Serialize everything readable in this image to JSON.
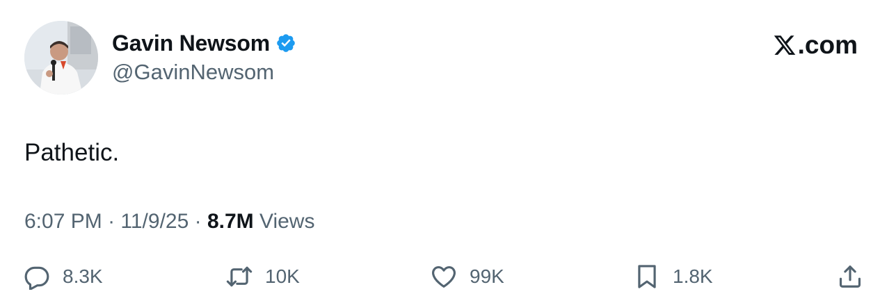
{
  "author": {
    "display_name": "Gavin Newsom",
    "handle": "@GavinNewsom",
    "verified_icon": "verified-badge-icon",
    "avatar": "profile-photo"
  },
  "brand": {
    "label": ".com",
    "logo_icon": "x-logo-icon"
  },
  "tweet": {
    "text": "Pathetic."
  },
  "meta": {
    "time": "6:07 PM",
    "separator": " · ",
    "date": "11/9/25",
    "views_count": "8.7M",
    "views_label": " Views"
  },
  "actions": {
    "reply": {
      "icon": "reply-icon",
      "count": "8.3K"
    },
    "retweet": {
      "icon": "retweet-icon",
      "count": "10K"
    },
    "like": {
      "icon": "heart-icon",
      "count": "99K"
    },
    "bookmark": {
      "icon": "bookmark-icon",
      "count": "1.8K"
    },
    "share": {
      "icon": "share-icon"
    }
  },
  "colors": {
    "text_primary": "#0f1419",
    "text_secondary": "#536471",
    "verified_blue": "#1d9bf0",
    "background": "#ffffff"
  }
}
